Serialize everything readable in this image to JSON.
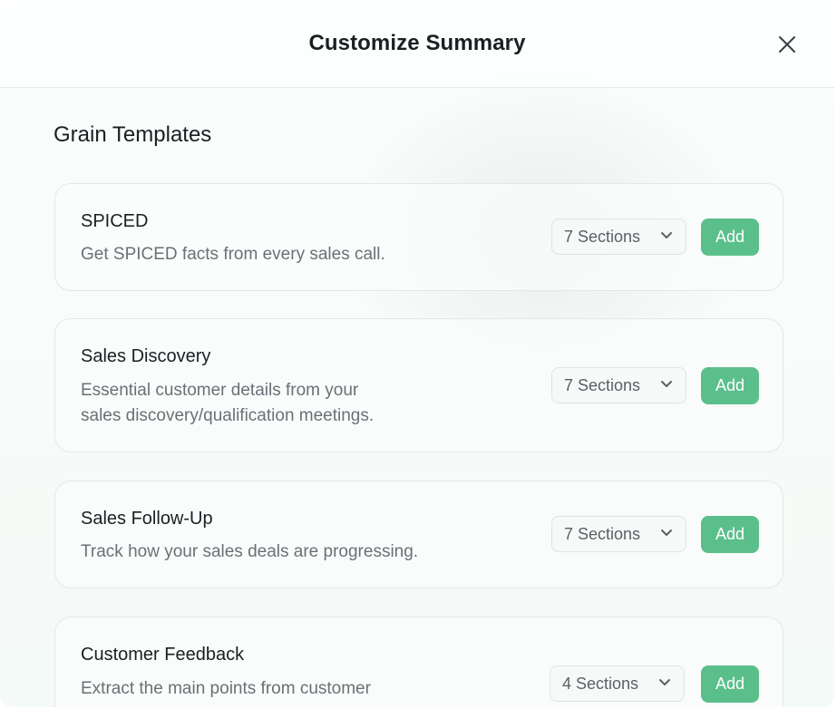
{
  "dialog": {
    "title": "Customize Summary",
    "close_icon": "close-icon"
  },
  "templates_heading": "Grain Templates",
  "templates": [
    {
      "name": "SPICED",
      "description_lines": [
        "Get SPICED facts from every sales call."
      ],
      "sections_label": "7 Sections",
      "add_label": "Add"
    },
    {
      "name": "Sales Discovery",
      "description_lines": [
        "Essential customer details from your",
        "sales discovery/qualification meetings."
      ],
      "sections_label": "7 Sections",
      "add_label": "Add"
    },
    {
      "name": "Sales Follow-Up",
      "description_lines": [
        "Track how your sales deals are progressing."
      ],
      "sections_label": "7 Sections",
      "add_label": "Add"
    },
    {
      "name": "Customer Feedback",
      "description_lines": [
        "Extract the main points from customer"
      ],
      "sections_label": "4 Sections",
      "add_label": "Add"
    }
  ],
  "colors": {
    "add_button": "#5bbf8c",
    "title_text": "#1b1f23",
    "description_text": "#6b7076"
  }
}
